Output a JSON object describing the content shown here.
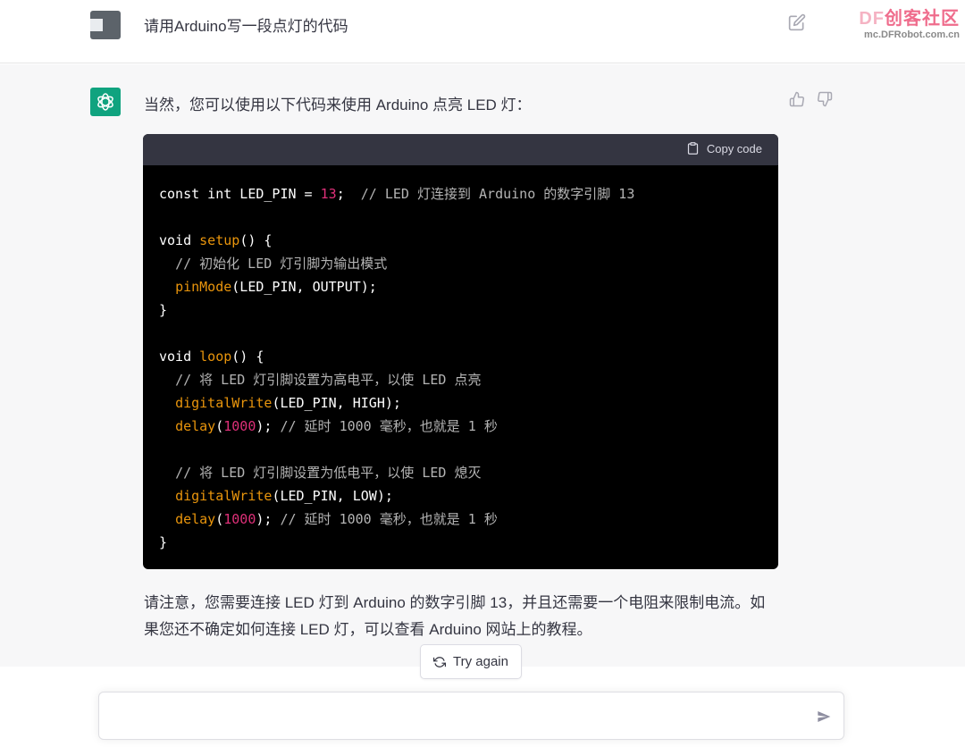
{
  "watermark": {
    "brand_prefix": "DF",
    "brand_text": "创客社区",
    "url": "mc.DFRobot.com.cn"
  },
  "user_message": {
    "text": "请用Arduino写一段点灯的代码"
  },
  "assistant": {
    "intro": "当然，您可以使用以下代码来使用 Arduino 点亮 LED 灯：",
    "copy_label": "Copy code",
    "code_comments": {
      "c1": "// LED 灯连接到 Arduino 的数字引脚 13",
      "c2": "// 初始化 LED 灯引脚为输出模式",
      "c3": "// 将 LED 灯引脚设置为高电平，以使 LED 点亮",
      "c4": "// 延时 1000 毫秒，也就是 1 秒",
      "c5": "// 将 LED 灯引脚设置为低电平，以使 LED 熄灭",
      "c6": "// 延时 1000 毫秒，也就是 1 秒"
    },
    "code_tokens": {
      "const": "const int LED_PIN = ",
      "pin_value": "13",
      "semicolon": ";  ",
      "void": "void ",
      "setup": "setup",
      "setup_tail": "() {",
      "pinMode": "pinMode",
      "pinMode_args": "(LED_PIN, OUTPUT);",
      "close": "}",
      "loop": "loop",
      "loop_tail": "() {",
      "digitalWrite": "digitalWrite",
      "dw_high": "(LED_PIN, HIGH);",
      "dw_low": "(LED_PIN, LOW);",
      "delay": "delay",
      "paren_open": "(",
      "delay_value": "1000",
      "delay_tail": "); "
    },
    "note": "请注意，您需要连接 LED 灯到 Arduino 的数字引脚 13，并且还需要一个电阻来限制电流。如果您还不确定如何连接 LED 灯，可以查看 Arduino 网站上的教程。"
  },
  "try_again": {
    "label": "Try again"
  },
  "composer": {
    "value": "",
    "placeholder": ""
  },
  "icons": {
    "edit": "edit-icon",
    "thumb_up": "thumb-up-icon",
    "thumb_down": "thumb-down-icon",
    "clipboard": "clipboard-icon",
    "refresh": "refresh-icon",
    "send": "send-icon",
    "openai": "openai-logo-icon"
  },
  "colors": {
    "brand_green": "#10a37f",
    "code_bg": "#000000",
    "code_header": "#343541",
    "number": "#df3079",
    "function": "#e9950c",
    "comment": "#b4b4b4"
  }
}
